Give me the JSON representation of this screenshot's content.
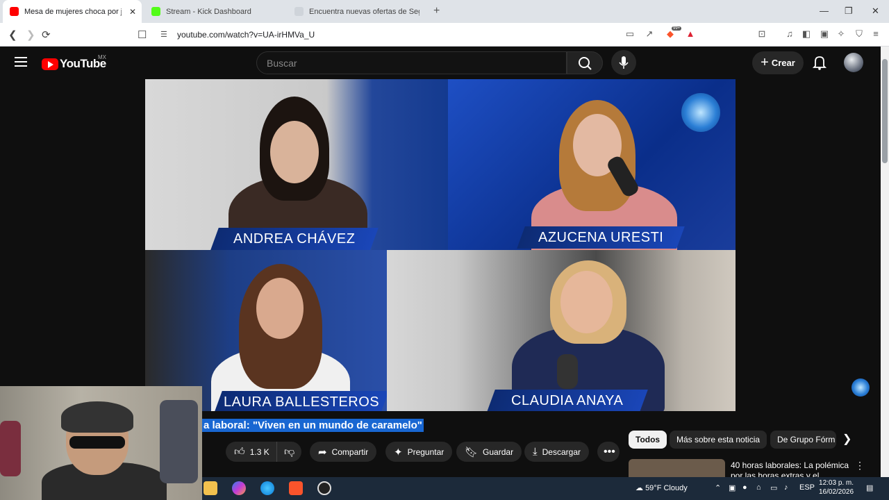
{
  "browser": {
    "tabs": [
      {
        "title": "Mesa de mujeres choca por jorn",
        "active": true
      },
      {
        "title": "Stream - Kick Dashboard",
        "active": false
      },
      {
        "title": "Encuentra nuevas ofertas de Segurid",
        "active": false
      }
    ],
    "url": "youtube.com/watch?v=UA-irHMVa_U",
    "extension_badge": "99+"
  },
  "youtube": {
    "logo_text": "YouTube",
    "country_code": "MX",
    "search_placeholder": "Buscar",
    "create_label": "Crear"
  },
  "video": {
    "panels": [
      {
        "name": "ANDREA CHÁVEZ"
      },
      {
        "name": "AZUCENA URESTI"
      },
      {
        "name": "LAURA BALLESTEROS"
      },
      {
        "name": "CLAUDIA ANAYA"
      }
    ],
    "title_fragment": "a laboral: \"Viven en un mundo de caramelo\"",
    "likes": "1.3 K",
    "actions": {
      "share": "Compartir",
      "ask": "Preguntar",
      "save": "Guardar",
      "download": "Descargar"
    }
  },
  "recommendations": {
    "chips": [
      "Todos",
      "Más sobre esta noticia",
      "De Grupo Fórm"
    ],
    "first_title": "40 horas laborales: La polémica por las horas extras y el"
  },
  "taskbar": {
    "weather": "59°F  Cloudy",
    "language": "ESP",
    "time": "12:03 p. m.",
    "date": "16/02/2026"
  },
  "colors": {
    "yt_red": "#ff0000",
    "nameplate_blue": "#1a46b8",
    "selection_blue": "#1967d2"
  }
}
